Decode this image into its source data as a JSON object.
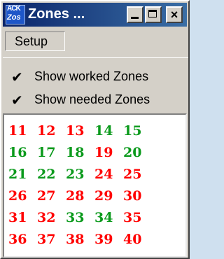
{
  "window": {
    "title": "Zones ...",
    "icon_top": "ACK",
    "icon_bottom": "Zos"
  },
  "menu": {
    "setup_label": "Setup"
  },
  "dropdown": {
    "items": [
      {
        "label": "Show worked Zones",
        "checked": true,
        "check_glyph": "✔"
      },
      {
        "label": "Show needed Zones",
        "checked": true,
        "check_glyph": "✔"
      }
    ]
  },
  "colors": {
    "needed": "#ff0000",
    "worked": "#0b9a1c",
    "title_bar": "#0a246a"
  },
  "zones": [
    [
      {
        "n": "11",
        "status": "needed"
      },
      {
        "n": "12",
        "status": "needed"
      },
      {
        "n": "13",
        "status": "needed"
      },
      {
        "n": "14",
        "status": "worked"
      },
      {
        "n": "15",
        "status": "worked"
      }
    ],
    [
      {
        "n": "16",
        "status": "worked"
      },
      {
        "n": "17",
        "status": "worked"
      },
      {
        "n": "18",
        "status": "worked"
      },
      {
        "n": "19",
        "status": "needed"
      },
      {
        "n": "20",
        "status": "worked"
      }
    ],
    [
      {
        "n": "21",
        "status": "worked"
      },
      {
        "n": "22",
        "status": "worked"
      },
      {
        "n": "23",
        "status": "worked"
      },
      {
        "n": "24",
        "status": "needed"
      },
      {
        "n": "25",
        "status": "needed"
      }
    ],
    [
      {
        "n": "26",
        "status": "needed"
      },
      {
        "n": "27",
        "status": "needed"
      },
      {
        "n": "28",
        "status": "needed"
      },
      {
        "n": "29",
        "status": "needed"
      },
      {
        "n": "30",
        "status": "needed"
      }
    ],
    [
      {
        "n": "31",
        "status": "needed"
      },
      {
        "n": "32",
        "status": "needed"
      },
      {
        "n": "33",
        "status": "worked"
      },
      {
        "n": "34",
        "status": "worked"
      },
      {
        "n": "35",
        "status": "needed"
      }
    ],
    [
      {
        "n": "36",
        "status": "needed"
      },
      {
        "n": "37",
        "status": "needed"
      },
      {
        "n": "38",
        "status": "needed"
      },
      {
        "n": "39",
        "status": "needed"
      },
      {
        "n": "40",
        "status": "needed"
      }
    ]
  ]
}
